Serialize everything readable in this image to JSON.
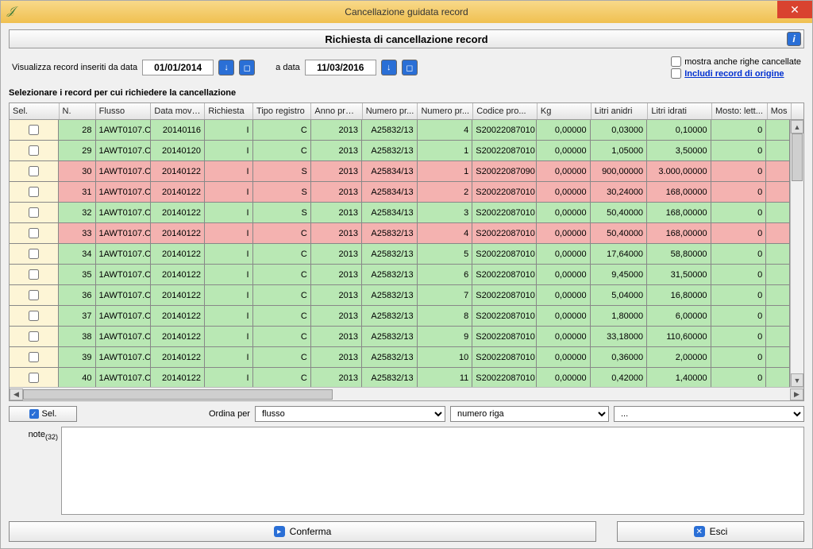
{
  "window": {
    "title": "Cancellazione guidata record"
  },
  "header": {
    "subtitle": "Richiesta di cancellazione record"
  },
  "filter": {
    "from_label": "Visualizza record inseriti da data",
    "from_value": "01/01/2014",
    "to_label": "a data",
    "to_value": "11/03/2016",
    "show_cancelled_label": "mostra anche righe cancellate",
    "include_origin_label": "Includi record di origine"
  },
  "section_label": "Selezionare i record per cui richiedere la cancellazione",
  "columns": [
    "Sel.",
    "N.",
    "Flusso",
    "Data mov/...",
    "Richiesta",
    "Tipo registro",
    "Anno prot...",
    "Numero pr...",
    "Numero pr...",
    "Codice pro...",
    "Kg",
    "Litri anidri",
    "Litri idrati",
    "Mosto: lett...",
    "Mos"
  ],
  "rows": [
    {
      "cls": "green",
      "n": "28",
      "flusso": "1AWT0107.C...",
      "data": "20140116",
      "rich": "I",
      "tipo": "C",
      "anno": "2013",
      "num1": "A25832/13",
      "num2": "4",
      "cod": "S20022087010",
      "kg": "0,00000",
      "la": "0,03000",
      "li": "0,10000",
      "mosto": "0"
    },
    {
      "cls": "green",
      "n": "29",
      "flusso": "1AWT0107.C...",
      "data": "20140120",
      "rich": "I",
      "tipo": "C",
      "anno": "2013",
      "num1": "A25832/13",
      "num2": "1",
      "cod": "S20022087010",
      "kg": "0,00000",
      "la": "1,05000",
      "li": "3,50000",
      "mosto": "0"
    },
    {
      "cls": "pink",
      "n": "30",
      "flusso": "1AWT0107.C...",
      "data": "20140122",
      "rich": "I",
      "tipo": "S",
      "anno": "2013",
      "num1": "A25834/13",
      "num2": "1",
      "cod": "S20022087090",
      "kg": "0,00000",
      "la": "900,00000",
      "li": "3.000,00000",
      "mosto": "0"
    },
    {
      "cls": "pink",
      "n": "31",
      "flusso": "1AWT0107.C...",
      "data": "20140122",
      "rich": "I",
      "tipo": "S",
      "anno": "2013",
      "num1": "A25834/13",
      "num2": "2",
      "cod": "S20022087010",
      "kg": "0,00000",
      "la": "30,24000",
      "li": "168,00000",
      "mosto": "0"
    },
    {
      "cls": "green",
      "n": "32",
      "flusso": "1AWT0107.C...",
      "data": "20140122",
      "rich": "I",
      "tipo": "S",
      "anno": "2013",
      "num1": "A25834/13",
      "num2": "3",
      "cod": "S20022087010",
      "kg": "0,00000",
      "la": "50,40000",
      "li": "168,00000",
      "mosto": "0"
    },
    {
      "cls": "pink",
      "n": "33",
      "flusso": "1AWT0107.C...",
      "data": "20140122",
      "rich": "I",
      "tipo": "C",
      "anno": "2013",
      "num1": "A25832/13",
      "num2": "4",
      "cod": "S20022087010",
      "kg": "0,00000",
      "la": "50,40000",
      "li": "168,00000",
      "mosto": "0"
    },
    {
      "cls": "green",
      "n": "34",
      "flusso": "1AWT0107.C...",
      "data": "20140122",
      "rich": "I",
      "tipo": "C",
      "anno": "2013",
      "num1": "A25832/13",
      "num2": "5",
      "cod": "S20022087010",
      "kg": "0,00000",
      "la": "17,64000",
      "li": "58,80000",
      "mosto": "0"
    },
    {
      "cls": "green",
      "n": "35",
      "flusso": "1AWT0107.C...",
      "data": "20140122",
      "rich": "I",
      "tipo": "C",
      "anno": "2013",
      "num1": "A25832/13",
      "num2": "6",
      "cod": "S20022087010",
      "kg": "0,00000",
      "la": "9,45000",
      "li": "31,50000",
      "mosto": "0"
    },
    {
      "cls": "green",
      "n": "36",
      "flusso": "1AWT0107.C...",
      "data": "20140122",
      "rich": "I",
      "tipo": "C",
      "anno": "2013",
      "num1": "A25832/13",
      "num2": "7",
      "cod": "S20022087010",
      "kg": "0,00000",
      "la": "5,04000",
      "li": "16,80000",
      "mosto": "0"
    },
    {
      "cls": "green",
      "n": "37",
      "flusso": "1AWT0107.C...",
      "data": "20140122",
      "rich": "I",
      "tipo": "C",
      "anno": "2013",
      "num1": "A25832/13",
      "num2": "8",
      "cod": "S20022087010",
      "kg": "0,00000",
      "la": "1,80000",
      "li": "6,00000",
      "mosto": "0"
    },
    {
      "cls": "green",
      "n": "38",
      "flusso": "1AWT0107.C...",
      "data": "20140122",
      "rich": "I",
      "tipo": "C",
      "anno": "2013",
      "num1": "A25832/13",
      "num2": "9",
      "cod": "S20022087010",
      "kg": "0,00000",
      "la": "33,18000",
      "li": "110,60000",
      "mosto": "0"
    },
    {
      "cls": "green",
      "n": "39",
      "flusso": "1AWT0107.C...",
      "data": "20140122",
      "rich": "I",
      "tipo": "C",
      "anno": "2013",
      "num1": "A25832/13",
      "num2": "10",
      "cod": "S20022087010",
      "kg": "0,00000",
      "la": "0,36000",
      "li": "2,00000",
      "mosto": "0"
    },
    {
      "cls": "green",
      "n": "40",
      "flusso": "1AWT0107.C...",
      "data": "20140122",
      "rich": "I",
      "tipo": "C",
      "anno": "2013",
      "num1": "A25832/13",
      "num2": "11",
      "cod": "S20022087010",
      "kg": "0,00000",
      "la": "0,42000",
      "li": "1,40000",
      "mosto": "0"
    }
  ],
  "under": {
    "sel_label": "Sel.",
    "order_label": "Ordina per",
    "order1": "flusso",
    "order2": "numero riga",
    "order3": "..."
  },
  "note": {
    "label_pre": "note",
    "label_sub": "(32)"
  },
  "footer": {
    "confirm": "Conferma",
    "exit": "Esci"
  }
}
